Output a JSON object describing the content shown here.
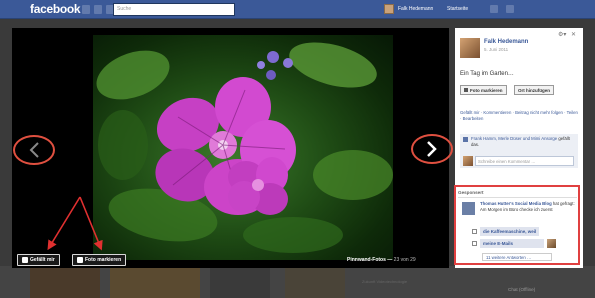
{
  "topbar": {
    "logo": "facebook",
    "search_placeholder": "Suche",
    "user_name": "Falk Hedemann",
    "home_label": "Startseite"
  },
  "photo_viewer": {
    "like_button": "Gefällt mir",
    "tag_button": "Foto markieren",
    "album_title": "Pinnwand-Fotos",
    "counter": "23 von 29"
  },
  "post": {
    "author": "Falk Hedemann",
    "date": "5. Juni 2011",
    "caption": "Ein Tag im Garten…",
    "tag_photo": "Foto markieren",
    "add_location": "Ort hinzufügen",
    "action_links": "Gefällt mir · Kommentieren · Beitrag nicht mehr folgen · Teilen · Bearbeiten",
    "likes_names": "Frank Hamm, Merle Düser und Mimi Ansorge",
    "likes_suffix": " gefällt das.",
    "comment_placeholder": "Schreibe einen Kommentar …"
  },
  "sponsored": {
    "heading": "Gesponsert",
    "page_name": "Thomas Hutter's Social Media Blog",
    "question": "hat gefragt: Am Morgen im Büro checke ich zuerst",
    "options": [
      "die Kaffeemaschine, weil",
      "meine E-Mails"
    ],
    "more_answers": "11 weitere Antworten …"
  },
  "background": {
    "chat_status": "Chat (Offline)",
    "bg_label": "Zukunft Videotechnologie"
  },
  "colors": {
    "fb_blue": "#3b5998",
    "highlight_red": "#e04040"
  }
}
